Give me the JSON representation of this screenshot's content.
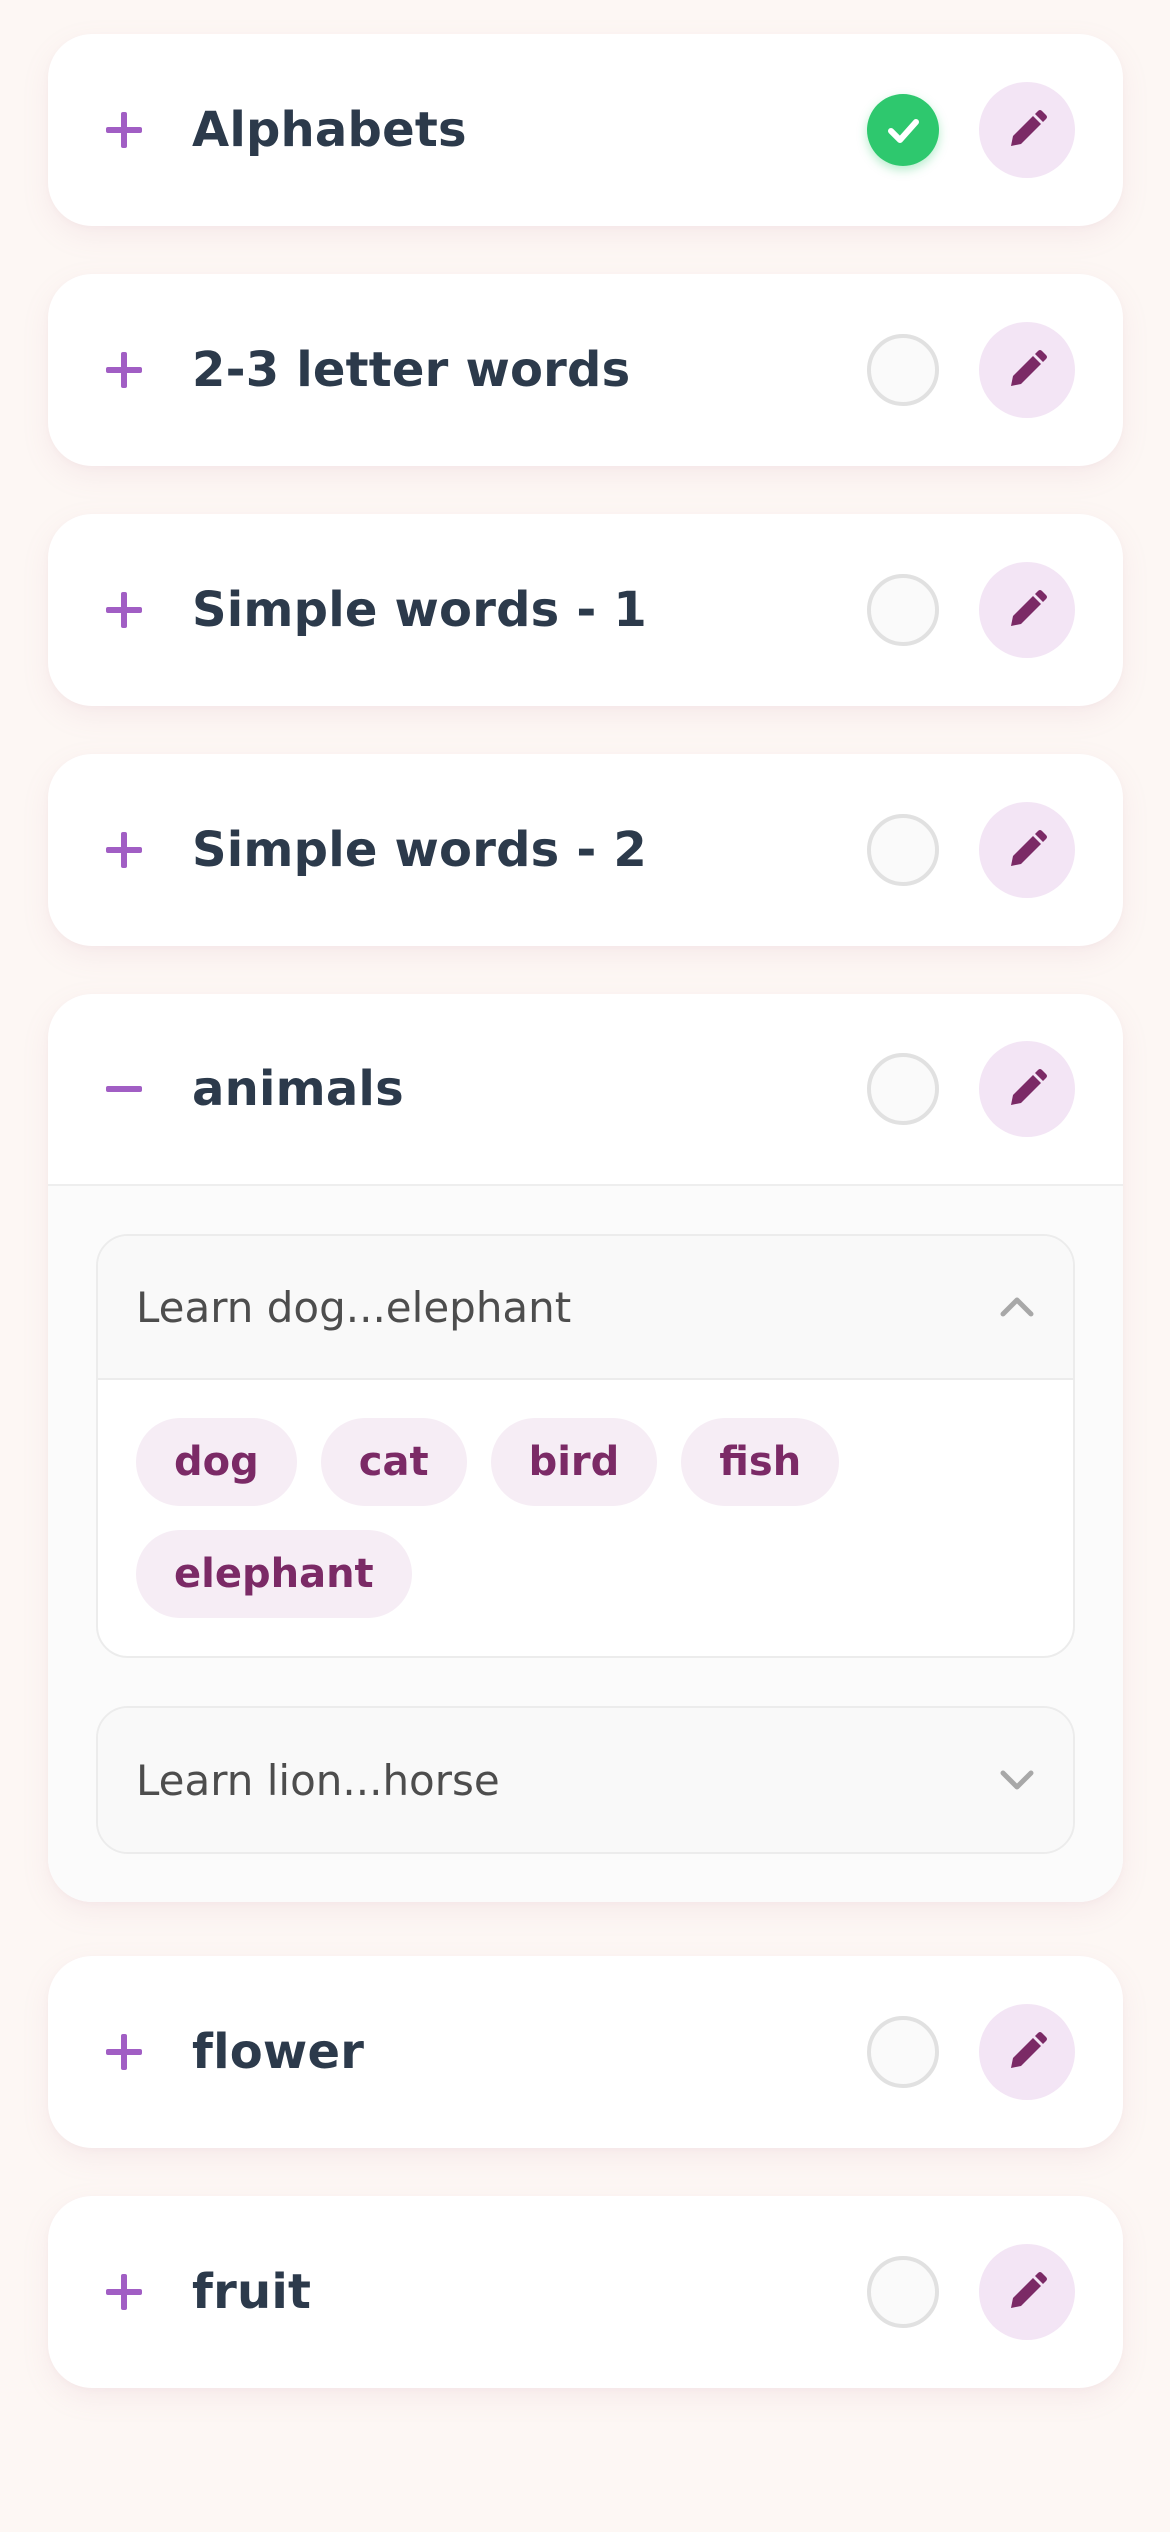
{
  "colors": {
    "page_bg": "#fdf7f4",
    "card_bg": "#ffffff",
    "title_text": "#2c3a4b",
    "toggle_purple": "#a15ec4",
    "edit_bg": "#f3e5f5",
    "edit_icon": "#7b2a66",
    "done_green": "#2ec86e",
    "chip_bg": "#f6edf5",
    "chip_text": "#7b2a66"
  },
  "categories": [
    {
      "title": "Alphabets",
      "expanded": false,
      "completed": true,
      "toggle_icon": "plus-icon",
      "status_icon": "check-icon",
      "edit_icon": "pencil-icon"
    },
    {
      "title": "2-3 letter words",
      "expanded": false,
      "completed": false,
      "toggle_icon": "plus-icon",
      "edit_icon": "pencil-icon"
    },
    {
      "title": "Simple words - 1",
      "expanded": false,
      "completed": false,
      "toggle_icon": "plus-icon",
      "edit_icon": "pencil-icon"
    },
    {
      "title": "Simple words - 2",
      "expanded": false,
      "completed": false,
      "toggle_icon": "plus-icon",
      "edit_icon": "pencil-icon"
    },
    {
      "title": "animals",
      "expanded": true,
      "completed": false,
      "toggle_icon": "minus-icon",
      "edit_icon": "pencil-icon",
      "lessons": [
        {
          "title": "Learn dog...elephant",
          "open": true,
          "chevron_icon": "chevron-up-icon",
          "words": [
            "dog",
            "cat",
            "bird",
            "fish",
            "elephant"
          ]
        },
        {
          "title": "Learn lion...horse",
          "open": false,
          "chevron_icon": "chevron-down-icon"
        }
      ]
    },
    {
      "title": "flower",
      "expanded": false,
      "completed": false,
      "toggle_icon": "plus-icon",
      "edit_icon": "pencil-icon"
    },
    {
      "title": "fruit",
      "expanded": false,
      "completed": false,
      "toggle_icon": "plus-icon",
      "edit_icon": "pencil-icon"
    }
  ]
}
